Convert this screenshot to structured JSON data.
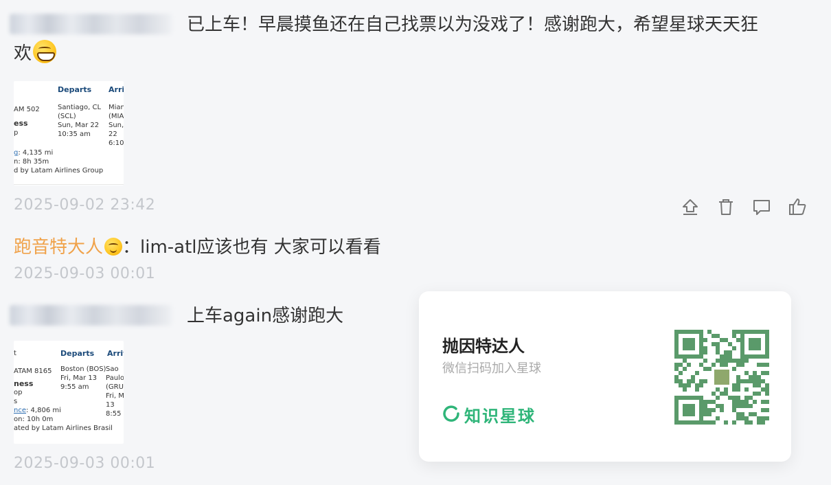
{
  "post1": {
    "message_line1": "已上车！早晨摸鱼还在自己找票以为没戏了！感谢跑大，希望星球天天狂",
    "message_line2": "欢",
    "emoji": "grinning-face-emoji",
    "ticket": {
      "flight": "AM 502",
      "cabin": "ess",
      "stop": "p",
      "departs_header": "Departs",
      "arrives_header": "Arri",
      "departs_city": "Santiago, CL",
      "departs_code": "(SCL)",
      "departs_date": "Sun, Mar 22",
      "departs_time": "10:35 am",
      "arrives_city": "Mian",
      "arrives_code": "(MIA",
      "arrives_date": "Sun,",
      "arrives_day": "22",
      "arrives_time": "6:10",
      "distance_label": "g",
      "distance": ": 4,135 mi",
      "duration": "n: 8h 35m",
      "operator": "d by Latam Airlines Group"
    },
    "timestamp": "2025-09-02 23:42"
  },
  "actions": [
    "share-icon",
    "delete-icon",
    "comment-icon",
    "like-icon"
  ],
  "comment": {
    "author": "跑音特大人",
    "emoji": "winking-face-emoji",
    "text": "：lim-atl应该也有 大家可以看看",
    "timestamp": "2025-09-03 00:01"
  },
  "post2": {
    "message": "上车again感谢跑大",
    "ticket": {
      "flight": "ATAM 8165",
      "cabin": "ness",
      "stop": "op",
      "departs_header": "Departs",
      "arrives_header": "Arriv",
      "departs_city": "Boston (BOS)",
      "departs_date": "Fri, Mar 13",
      "departs_time": "9:55 am",
      "arrives_city": "Sao",
      "arrives_city2": "Paulo,",
      "arrives_code": "(GRU)",
      "arrives_date": "Fri, M",
      "arrives_day": "13",
      "arrives_time": "8:55 p",
      "distance_label": "s",
      "distance_link": "nce",
      "distance": ": 4,806 mi",
      "duration": "on: 10h 0m",
      "operator": "ated by Latam Airlines Brasil"
    },
    "timestamp": "2025-09-03 00:01"
  },
  "card": {
    "name": "抛因特达人",
    "subtitle": "微信扫码加入星球",
    "brand": "知识星球",
    "brand_color": "#2fb579",
    "qr_color": "#5a9a6a"
  }
}
